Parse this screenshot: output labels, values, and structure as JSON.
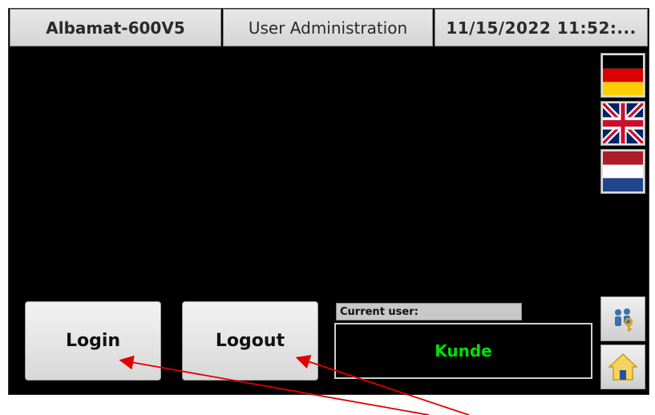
{
  "header": {
    "app_name": "Albamat-600V5",
    "section": "User Administration",
    "datetime": "11/15/2022 11:52:..."
  },
  "languages": [
    {
      "name": "German",
      "icon": "germany-flag-icon"
    },
    {
      "name": "English",
      "icon": "uk-flag-icon"
    },
    {
      "name": "Dutch",
      "icon": "netherlands-flag-icon"
    }
  ],
  "buttons": {
    "login_label": "Login",
    "logout_label": "Logout"
  },
  "current_user": {
    "label": "Current user:",
    "value": "Kunde",
    "value_color": "#00e000"
  },
  "side_buttons": [
    {
      "icon": "users-key-icon"
    },
    {
      "icon": "home-icon"
    }
  ],
  "colors": {
    "background": "#000000",
    "annotation_arrow": "#e00000"
  }
}
